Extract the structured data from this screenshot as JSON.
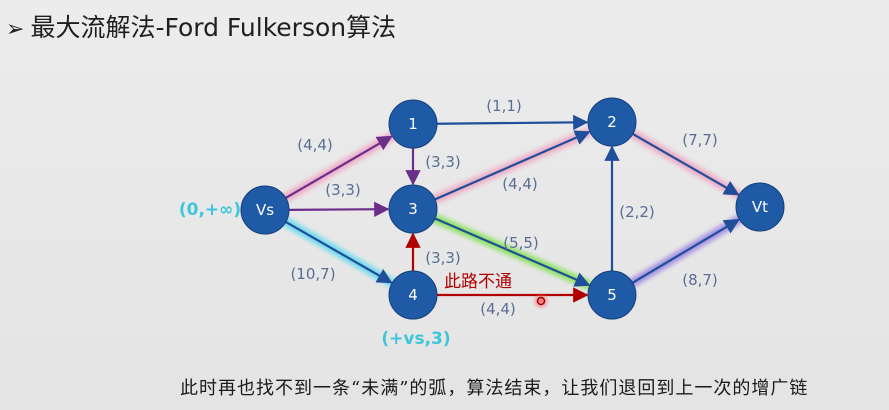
{
  "title": "最大流解法-Ford Fulkerson算法",
  "caption": "此时再也找不到一条“未满”的弧，算法结束，让我们退回到上一次的增广链",
  "diagram": {
    "nodes": [
      {
        "id": "vs",
        "label": "Vs"
      },
      {
        "id": "n1",
        "label": "1"
      },
      {
        "id": "n2",
        "label": "2"
      },
      {
        "id": "n3",
        "label": "3"
      },
      {
        "id": "n4",
        "label": "4"
      },
      {
        "id": "n5",
        "label": "5"
      },
      {
        "id": "vt",
        "label": "Vt"
      }
    ],
    "edges": [
      {
        "from": "vs",
        "to": "n1",
        "label": "(4,4)",
        "glow": "#f0a0c0"
      },
      {
        "from": "vs",
        "to": "n3",
        "label": "(3,3)",
        "glow": "#f5f542"
      },
      {
        "from": "vs",
        "to": "n4",
        "label": "(10,7)",
        "glow": "#58d8f0"
      },
      {
        "from": "n1",
        "to": "n2",
        "label": "(1,1)",
        "glow": ""
      },
      {
        "from": "n1",
        "to": "n3",
        "label": "(3,3)",
        "glow": "#f0a0c0"
      },
      {
        "from": "n3",
        "to": "n2",
        "label": "(4,4)",
        "glow": "#f0a0c0"
      },
      {
        "from": "n2",
        "to": "vt",
        "label": "(7,7)",
        "glow": "#f0a0c0"
      },
      {
        "from": "n3",
        "to": "n5",
        "label": "(5,5)",
        "glow": "#7de04a"
      },
      {
        "from": "n4",
        "to": "n3",
        "label": "(3,3)",
        "glow": ""
      },
      {
        "from": "n4",
        "to": "n5",
        "label": "(4,4)",
        "glow": ""
      },
      {
        "from": "n5",
        "to": "n2",
        "label": "(2,2)",
        "glow": ""
      },
      {
        "from": "n5",
        "to": "vt",
        "label": "(8,7)",
        "glow": "#9a80e0"
      }
    ],
    "node_labels": {
      "vs": "(0,+∞)",
      "n4": "(+vs,3)"
    },
    "blocked_note": "此路不通",
    "colors": {
      "node": "#1f5aa6",
      "edge": "#1f4f9a",
      "tight_edge": "#b00000",
      "label": "#5a6e95",
      "node_label": "#3ec6da"
    }
  }
}
